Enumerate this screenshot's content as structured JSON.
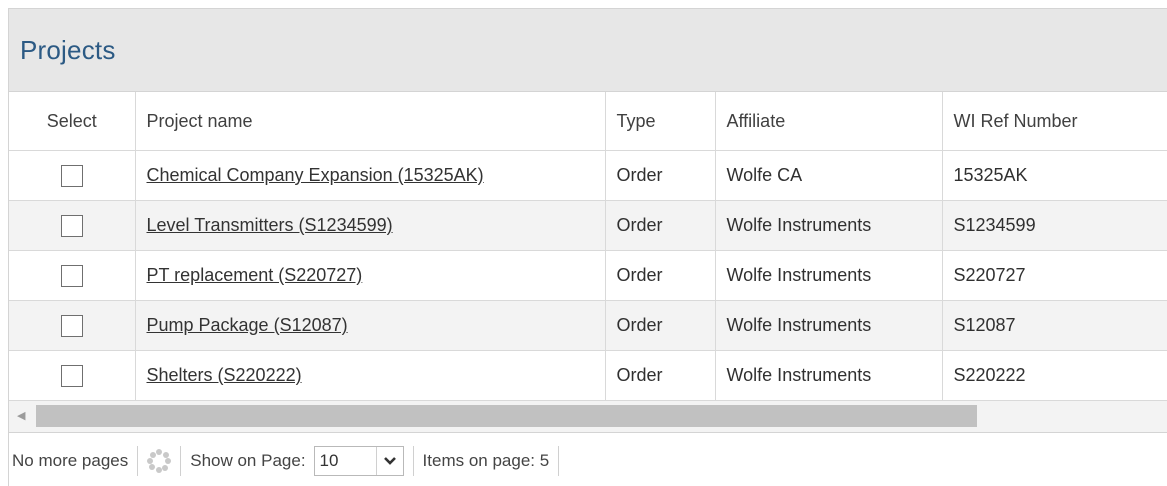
{
  "panel": {
    "title": "Projects"
  },
  "table": {
    "columns": [
      "Select",
      "Project name",
      "Type",
      "Affiliate",
      "WI Ref Number"
    ],
    "rows": [
      {
        "name": "Chemical Company Expansion (15325AK)",
        "type": "Order",
        "affiliate": "Wolfe CA",
        "ref": "15325AK",
        "selected": false
      },
      {
        "name": "Level Transmitters (S1234599)",
        "type": "Order",
        "affiliate": "Wolfe Instruments",
        "ref": "S1234599",
        "selected": false
      },
      {
        "name": "PT replacement (S220727)",
        "type": "Order",
        "affiliate": "Wolfe Instruments",
        "ref": "S220727",
        "selected": false
      },
      {
        "name": "Pump Package (S12087)",
        "type": "Order",
        "affiliate": "Wolfe Instruments",
        "ref": "S12087",
        "selected": false
      },
      {
        "name": "Shelters (S220222)",
        "type": "Order",
        "affiliate": "Wolfe Instruments",
        "ref": "S220222",
        "selected": false
      }
    ]
  },
  "scrollbar": {
    "left_arrow_icon": "triangle-left-icon"
  },
  "pager": {
    "status": "No more pages",
    "refresh_icon": "loading-spinner-icon",
    "show_on_page_label": "Show on Page:",
    "page_size": "10",
    "dropdown_icon": "chevron-down-icon",
    "items_on_page": "Items on page: 5"
  }
}
